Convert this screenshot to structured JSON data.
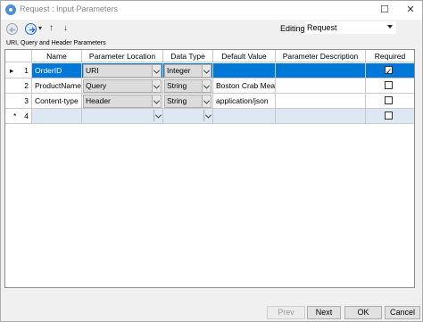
{
  "window": {
    "title": "Request : Input Parameters"
  },
  "toolbar": {
    "editing_label": "Editing:",
    "editing_value": "Request"
  },
  "section_label": "URI, Query and Header Parameters",
  "grid": {
    "columns": [
      "Name",
      "Parameter Location",
      "Data Type",
      "Default Value",
      "Parameter Description",
      "Required"
    ],
    "rows": [
      {
        "num": "1",
        "marker": "▸",
        "name": "OrderID",
        "location": "URI",
        "type": "Integer",
        "default": "",
        "description": "",
        "required": true
      },
      {
        "num": "2",
        "marker": "",
        "name": "ProductName",
        "location": "Query",
        "type": "String",
        "default": "Boston Crab Meat",
        "description": "",
        "required": false
      },
      {
        "num": "3",
        "marker": "",
        "name": "Content-type",
        "location": "Header",
        "type": "String",
        "default": "application/json",
        "description": "",
        "required": false
      },
      {
        "num": "4",
        "marker": "*",
        "name": "",
        "location": "",
        "type": "",
        "default": "",
        "description": "",
        "required": false
      }
    ]
  },
  "footer": {
    "prev": "Prev",
    "next": "Next",
    "ok": "OK",
    "cancel": "Cancel"
  }
}
